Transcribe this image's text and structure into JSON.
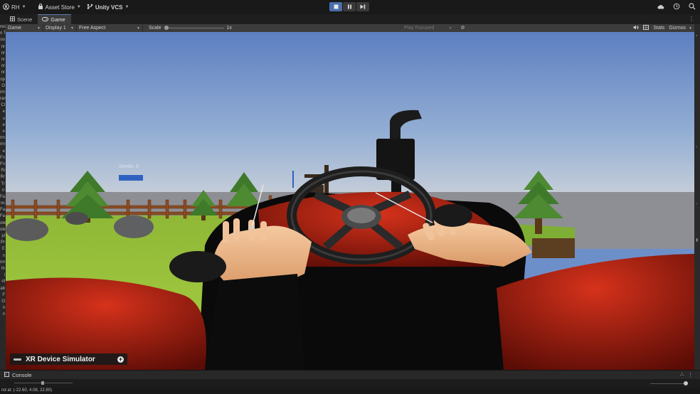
{
  "toolbar": {
    "account": "RH",
    "asset_store": "Asset Store",
    "vcs": "Unity VCS"
  },
  "tabs": [
    {
      "label": "Scene",
      "icon": "scene-icon"
    },
    {
      "label": "Game",
      "icon": "gamepad-icon"
    }
  ],
  "game_bar": {
    "view_mode": "Game",
    "display": "Display 1",
    "aspect": "Free Aspect",
    "scale_label": "Scale",
    "scale_value": "1x",
    "play_mode": "Play Focused",
    "stats": "Stats",
    "gizmos": "Gizmos"
  },
  "left_strip": [
    "rec",
    "n T",
    "ou",
    "nr",
    "nr",
    "nr",
    "nr",
    "nr",
    "op",
    "O",
    "rm",
    "ran",
    "Cl",
    "e",
    "u",
    "e",
    "e",
    "rm",
    "rm",
    "e",
    "Fn",
    "Fn",
    "Ri",
    "Rr",
    "Tr",
    "rr",
    "Fa",
    "nc",
    "Fa",
    "Fa",
    "ole",
    "ole",
    "pl",
    "Pr",
    "E",
    "n",
    "rm",
    "th",
    "i",
    "rll",
    "ab",
    "F",
    "O",
    "n",
    "n"
  ],
  "hud": {
    "seeds_label": "Seeds: 5",
    "seeds_fill": 1.0
  },
  "xr_panel": {
    "title": "XR Device Simulator"
  },
  "console": {
    "label": "Console"
  },
  "status_line": "nd at: (-22.60, 4.08, 22.80)",
  "colors": {
    "play_active": "#4a6ea8",
    "tab_accent": "#5a7bb5",
    "hud_bar": "#2f62c0"
  }
}
